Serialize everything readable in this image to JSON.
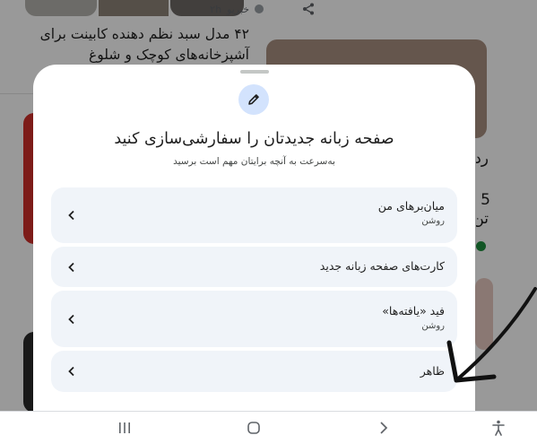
{
  "background": {
    "headline": "۴۲ مدل سبد نظم دهنده کابینت برای آشپزخانه‌های کوچک و شلوغ",
    "source": "خبریو",
    "time_ago": "۲h",
    "right_card_fragments": [
      "رد",
      "5",
      "تن"
    ]
  },
  "sheet": {
    "title": "صفحه زبانه جدیدتان را سفارشی‌سازی کنید",
    "subtitle": "به‌سرعت به آنچه برایتان مهم است برسید",
    "options": [
      {
        "label": "میان‌برهای من",
        "status": "روشن"
      },
      {
        "label": "کارت‌های صفحه زبانه جدید",
        "status": ""
      },
      {
        "label": "فید «یافته‌ها»",
        "status": "روشن"
      },
      {
        "label": "ظاهر",
        "status": ""
      }
    ]
  },
  "icons": {
    "edit": "pencil-icon",
    "chevron": "chevron-left-icon",
    "share": "share-icon",
    "nav_recents": "recent-apps-icon",
    "nav_home": "home-icon",
    "nav_back": "back-icon",
    "nav_accessibility": "accessibility-icon"
  },
  "colors": {
    "option_bg": "#f0f4f9",
    "accent_circle": "#d3e3fd",
    "scrim": "rgba(0,0,0,0.40)"
  }
}
